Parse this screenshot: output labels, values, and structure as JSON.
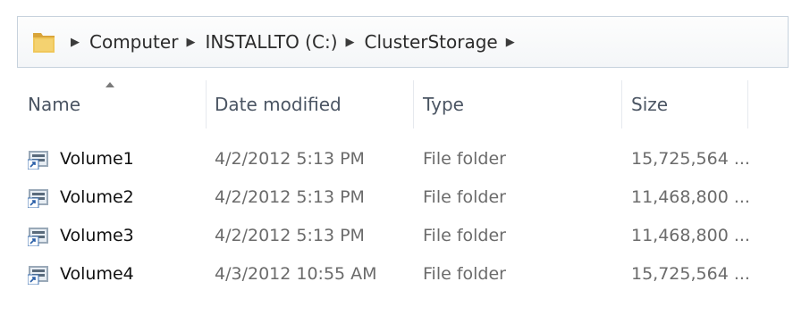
{
  "address_bar": {
    "icon": "folder-icon",
    "separator_icon": "right-triangle-icon",
    "crumbs": [
      "Computer",
      "INSTALLTO (C:)",
      "ClusterStorage"
    ]
  },
  "columns": {
    "name": "Name",
    "date_modified": "Date modified",
    "type": "Type",
    "size": "Size",
    "sorted_by": "Name",
    "sort_indicator_icon": "sort-up-arrow-icon"
  },
  "rows": [
    {
      "icon": "volume-mountpoint-icon",
      "name": "Volume1",
      "date_modified": "4/2/2012 5:13 PM",
      "type": "File folder",
      "size": "15,725,564 ..."
    },
    {
      "icon": "volume-mountpoint-icon",
      "name": "Volume2",
      "date_modified": "4/2/2012 5:13 PM",
      "type": "File folder",
      "size": "11,468,800 ..."
    },
    {
      "icon": "volume-mountpoint-icon",
      "name": "Volume3",
      "date_modified": "4/2/2012 5:13 PM",
      "type": "File folder",
      "size": "11,468,800 ..."
    },
    {
      "icon": "volume-mountpoint-icon",
      "name": "Volume4",
      "date_modified": "4/3/2012 10:55 AM",
      "type": "File folder",
      "size": "15,725,564 ..."
    }
  ],
  "colors": {
    "address_border": "#c7d2dd",
    "header_text": "#4b5563",
    "secondary_text": "#6b6b6b",
    "folder_yellow": "#e8b84a"
  }
}
